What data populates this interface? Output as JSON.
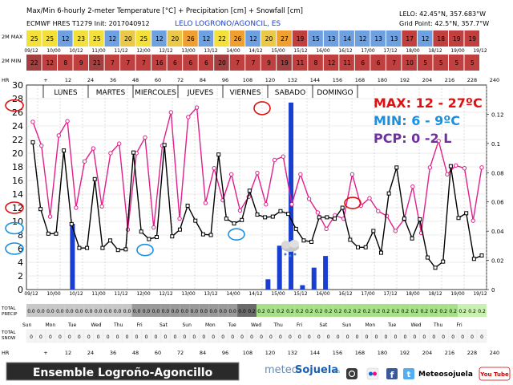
{
  "header": {
    "title": "Max/Min 6-hourly 2-meter Temperature [°C] + Precipitation [cm] + Snowfall [cm]",
    "model": "ECMWF HRES T1279 Init: 2017040912",
    "location": "LELO LOGRONO/AGONCIL, ES",
    "coords": "LELO: 42.45°N, 357.683°W",
    "grid_point": "Grid Point: 42.5°N, 357.7°W"
  },
  "rows": {
    "max_label": "2M MAX",
    "min_label": "2M MIN",
    "hr_label": "HR",
    "precip_label_1": "TOTAL",
    "precip_label_2": "PRECIP",
    "snow_label_1": "TOTAL",
    "snow_label_2": "SNOW",
    "max_values": [
      "25",
      "25",
      "12",
      "23",
      "25",
      "12",
      "20",
      "25",
      "12",
      "20",
      "26",
      "12",
      "22",
      "26",
      "12",
      "20",
      "27",
      "19",
      "15",
      "13",
      "14",
      "12",
      "13",
      "13",
      "17",
      "12",
      "18",
      "19",
      "19"
    ],
    "min_values": [
      "22",
      "12",
      "8",
      "9",
      "21",
      "7",
      "7",
      "7",
      "16",
      "6",
      "6",
      "6",
      "20",
      "7",
      "7",
      "9",
      "19",
      "11",
      "8",
      "12",
      "11",
      "6",
      "6",
      "7",
      "10",
      "5",
      "5",
      "5",
      "5"
    ],
    "max_colors": [
      "#f3e03a",
      "#f3e03a",
      "#6fa0e0",
      "#f3e03a",
      "#f3e03a",
      "#6fa0e0",
      "#e9c84a",
      "#f3e03a",
      "#6fa0e0",
      "#e9c84a",
      "#f0a030",
      "#6fa0e0",
      "#f3e03a",
      "#f0a030",
      "#6fa0e0",
      "#e9c84a",
      "#f0a030",
      "#c04040",
      "#6fa0e0",
      "#6fa0e0",
      "#6fa0e0",
      "#6fa0e0",
      "#6fa0e0",
      "#6fa0e0",
      "#c04040",
      "#6fa0e0",
      "#c04040",
      "#c04040",
      "#c04040"
    ],
    "min_colors": [
      "#a04040",
      "#c04040",
      "#c04040",
      "#c04040",
      "#a04040",
      "#c04040",
      "#c04040",
      "#c04040",
      "#c04040",
      "#c04040",
      "#c04040",
      "#c04040",
      "#a04040",
      "#c04040",
      "#c04040",
      "#c04040",
      "#a04040",
      "#c04040",
      "#c04040",
      "#c04040",
      "#c04040",
      "#c04040",
      "#c04040",
      "#c04040",
      "#c04040",
      "#c04040",
      "#c04040",
      "#c04040",
      "#c04040"
    ],
    "precip_values": [
      "0.0",
      "0.0",
      "0.0",
      "0.0",
      "0.0",
      "0.0",
      "0.0",
      "0.0",
      "0.0",
      "0.0",
      "0.0",
      "0.0",
      "0.0",
      "0.0",
      "0.0",
      "0.0",
      "0.0",
      "0.0",
      "0.0",
      "0.0",
      "0.0",
      "0.0",
      "0.0",
      "0.2",
      "0.2",
      "0.2",
      "0.2",
      "0.2",
      "0.2",
      "0.2",
      "0.2",
      "0.2",
      "0.2",
      "0.2",
      "0.2",
      "0.2",
      "0.2",
      "0.2",
      "0.2",
      "0.2",
      "0.2",
      "0.2",
      "0.2",
      "0.2",
      "0.2",
      "0.2",
      "0.2",
      "0.2"
    ],
    "snow_values": [
      "0",
      "0",
      "0",
      "0",
      "0",
      "0",
      "0",
      "0",
      "0",
      "0",
      "0",
      "0",
      "0",
      "0",
      "0",
      "0",
      "0",
      "0",
      "0",
      "0",
      "0",
      "0",
      "0",
      "0",
      "0",
      "0",
      "0",
      "0",
      "0",
      "0",
      "0",
      "0",
      "0",
      "0",
      "0",
      "0",
      "0",
      "0",
      "0",
      "0",
      "0",
      "0",
      "0",
      "0",
      "0",
      "0",
      "0",
      "0"
    ],
    "weekdays": [
      "Sun",
      "Mon",
      "Tue",
      "Wed",
      "Thu",
      "Fri",
      "Sat",
      "Sun",
      "Mon",
      "Tue",
      "Wed",
      "Thu",
      "Fri",
      "Sat",
      "Sun",
      "Mon",
      "Tue",
      "Wed",
      "Thu",
      "Fri"
    ],
    "weekdays_bottom": [
      "Sun",
      "Mon",
      "Tue",
      "Wed",
      "Thu",
      "Fri",
      "Sat",
      "Sun",
      "Mon",
      "Tue",
      "Wed",
      "Thu",
      "Fri",
      "Sat",
      "Sun",
      "Mon",
      "Tue",
      "Wed",
      "Thu",
      "Fri"
    ]
  },
  "overlay": {
    "days": [
      "LUNES",
      "MARTES",
      "MIERCOLES",
      "JUEVES",
      "VIERNES",
      "SABADO",
      "DOMINGO"
    ],
    "max_text": "MAX: 12 - 27ºC",
    "min_text": "MIN: 6 - 9ºC",
    "pcp_text": "PCP: 0 -2 L"
  },
  "footer": {
    "banner": "Ensemble Logroño-Agoncillo",
    "logo_text_1": "meteo",
    "logo_text_2": "Sojuela",
    "logo_domain": ".es",
    "brand": "Meteosojuela",
    "youtube": "You Tube"
  },
  "colors": {
    "max_line": "#e0208c",
    "min_line": "#000000",
    "precip_bar": "#1a3fd0",
    "precip_bar_dark": "#4a4a4a",
    "max_text": "#e01010",
    "min_text": "#1a90e0",
    "pcp_text": "#7030a0",
    "circle_red": "#e01010",
    "circle_blue": "#1a90e0"
  },
  "chart_data": {
    "type": "line",
    "y_ticks": [
      "0",
      "2",
      "4",
      "6",
      "8",
      "10",
      "12",
      "14",
      "16",
      "18",
      "20",
      "22",
      "24",
      "26",
      "28",
      "30"
    ],
    "y_ticks_right": [
      "0",
      "0.02",
      "0.04",
      "0.06",
      "0.08",
      "0.1",
      "0.12"
    ],
    "x_hours": [
      "+",
      "12",
      "24",
      "36",
      "48",
      "60",
      "72",
      "84",
      "96",
      "108",
      "120",
      "132",
      "144",
      "156",
      "168",
      "180",
      "192",
      "204",
      "216",
      "228",
      "240"
    ],
    "x_dates": [
      "09/12",
      "10/00",
      "10/12",
      "11/00",
      "11/12",
      "12/00",
      "12/12",
      "13/00",
      "13/12",
      "14/00",
      "14/12",
      "15/00",
      "15/12",
      "16/00",
      "16/12",
      "17/00",
      "17/12",
      "18/00",
      "18/12",
      "19/00",
      "19/12"
    ],
    "ylim": [
      0,
      30
    ],
    "ylim_right": [
      0,
      0.14
    ],
    "series": [
      {
        "values": [
          24.6,
          21.1,
          10.7,
          22.6,
          24.7,
          12.0,
          18.8,
          20.7,
          12.2,
          20.0,
          21.4,
          8.8,
          20.0,
          22.3,
          9.1,
          21.1,
          26.0,
          10.4,
          25.3,
          26.7,
          12.7,
          17.8,
          13.1,
          16.9,
          11.6,
          13.6,
          17.1,
          12.5,
          19.0,
          19.5,
          12.5,
          16.9,
          13.3,
          11.3,
          8.9,
          10.9,
          10.4,
          16.9,
          12.3,
          13.4,
          11.5,
          10.8,
          8.6,
          10.3,
          15.1,
          8.3,
          17.9,
          21.8,
          16.9,
          18.2,
          17.8,
          10.1,
          17.9
        ]
      },
      {
        "values": [
          21.6,
          11.8,
          8.2,
          8.2,
          20.4,
          9.6,
          6.1,
          6.1,
          16.2,
          6.1,
          7.2,
          5.8,
          5.9,
          20.1,
          8.5,
          7.4,
          7.7,
          21.2,
          7.8,
          8.8,
          12.3,
          10.1,
          8.1,
          8.0,
          19.8,
          10.4,
          9.7,
          10.2,
          14.5,
          11.0,
          10.6,
          10.7,
          11.5,
          11.1,
          8.9,
          7.2,
          7.0,
          10.6,
          10.6,
          10.4,
          12.0,
          7.3,
          6.2,
          6.2,
          8.6,
          5.4,
          14.1,
          17.9,
          10.4,
          7.5,
          10.3,
          4.7,
          3.2,
          4.1,
          18.1,
          10.5,
          11.2,
          4.5,
          5.0
        ]
      },
      {
        "values": [
          0,
          0,
          0,
          0,
          0.045,
          0,
          0,
          0,
          0,
          0,
          0,
          0,
          0,
          0,
          0,
          0,
          0,
          0,
          0,
          0,
          0,
          0.007,
          0.03,
          0.128,
          0.003,
          0.015,
          0.023,
          0,
          0,
          0,
          0,
          0,
          0,
          0,
          0,
          0,
          0,
          0,
          0,
          0,
          0
        ]
      }
    ]
  }
}
